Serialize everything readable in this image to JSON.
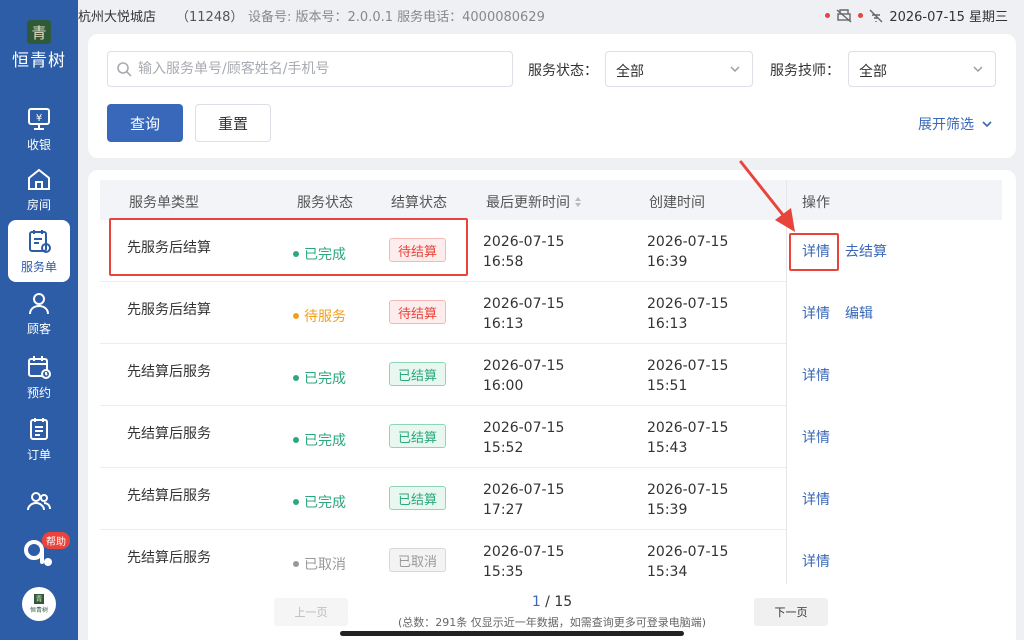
{
  "app": {
    "logo_mark": "青",
    "logo_text": "恒青树",
    "bottom_logo_mark": "青",
    "bottom_logo_text": "恒青树"
  },
  "statusbar": {
    "store": "杭州大悦城店",
    "store_code": "（11248）",
    "device": "设备号: 版本号：2.0.0.1 服务电话：4000080629",
    "datetime": "2026-07-15 星期三"
  },
  "sidebar": {
    "items": [
      {
        "label": "收银",
        "icon": "cashier-icon"
      },
      {
        "label": "房间",
        "icon": "home-icon"
      },
      {
        "label": "服务单",
        "icon": "service-order-icon"
      },
      {
        "label": "顾客",
        "icon": "customer-icon"
      },
      {
        "label": "预约",
        "icon": "calendar-icon"
      },
      {
        "label": "订单",
        "icon": "order-icon"
      },
      {
        "label": "",
        "icon": "staff-icon"
      }
    ],
    "help_label": "帮助"
  },
  "filters": {
    "search_placeholder": "输入服务单号/顾客姓名/手机号",
    "status_label": "服务状态：",
    "status_value": "全部",
    "tech_label": "服务技师：",
    "tech_value": "全部",
    "query_label": "查询",
    "reset_label": "重置",
    "expand_label": "展开筛选"
  },
  "colors": {
    "primary": "#3967b9",
    "sidebar": "#2e5da8",
    "danger": "#e8443c",
    "success": "#2ba87c",
    "warning": "#f0a020"
  },
  "table": {
    "headers": {
      "type": "服务单类型",
      "service_status": "服务状态",
      "settle_status": "结算状态",
      "updated": "最后更新时间",
      "created": "创建时间",
      "ops": "操作"
    },
    "rows": [
      {
        "type": "先服务后结算",
        "service_status": "已完成",
        "status_kind": "done",
        "settle": "待结算",
        "settle_kind": "pending",
        "updated_date": "2026-07-15",
        "updated_time": "16:58",
        "created_date": "2026-07-15",
        "created_time": "16:39",
        "op1": "详情",
        "op2": "去结算"
      },
      {
        "type": "先服务后结算",
        "service_status": "待服务",
        "status_kind": "waiting",
        "settle": "待结算",
        "settle_kind": "pending",
        "updated_date": "2026-07-15",
        "updated_time": "16:13",
        "created_date": "2026-07-15",
        "created_time": "16:13",
        "op1": "详情",
        "op2": "编辑"
      },
      {
        "type": "先结算后服务",
        "service_status": "已完成",
        "status_kind": "done",
        "settle": "已结算",
        "settle_kind": "paid",
        "updated_date": "2026-07-15",
        "updated_time": "16:00",
        "created_date": "2026-07-15",
        "created_time": "15:51",
        "op1": "详情",
        "op2": ""
      },
      {
        "type": "先结算后服务",
        "service_status": "已完成",
        "status_kind": "done",
        "settle": "已结算",
        "settle_kind": "paid",
        "updated_date": "2026-07-15",
        "updated_time": "15:52",
        "created_date": "2026-07-15",
        "created_time": "15:43",
        "op1": "详情",
        "op2": ""
      },
      {
        "type": "先结算后服务",
        "service_status": "已完成",
        "status_kind": "done",
        "settle": "已结算",
        "settle_kind": "paid",
        "updated_date": "2026-07-15",
        "updated_time": "17:27",
        "created_date": "2026-07-15",
        "created_time": "15:39",
        "op1": "详情",
        "op2": ""
      },
      {
        "type": "先结算后服务",
        "service_status": "已取消",
        "status_kind": "cancel",
        "settle": "已取消",
        "settle_kind": "cancel",
        "updated_date": "2026-07-15",
        "updated_time": "15:35",
        "created_date": "2026-07-15",
        "created_time": "15:34",
        "op1": "详情",
        "op2": ""
      }
    ]
  },
  "pagination": {
    "prev_label": "上一页",
    "next_label": "下一页",
    "current": "1",
    "separator": " / ",
    "total_pages": "15",
    "total_text": "(总数：291条 仅显示近一年数据，如需查询更多可登录电脑端)"
  }
}
